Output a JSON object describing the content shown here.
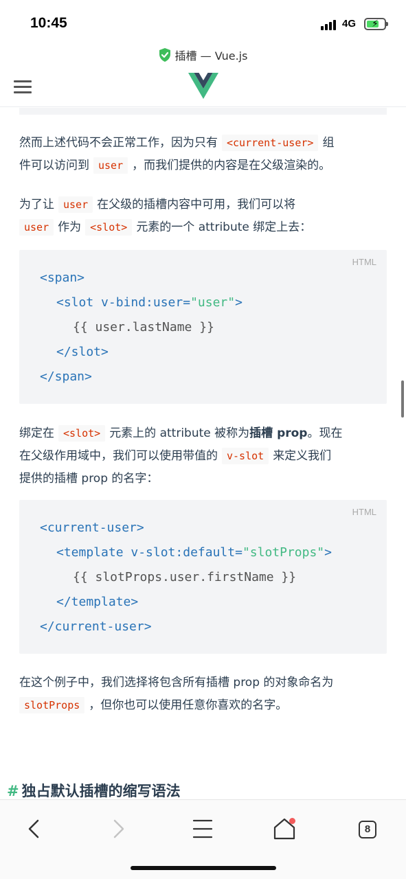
{
  "status_bar": {
    "time": "10:45",
    "network": "4G",
    "battery_level": 0.7,
    "battery_color": "#4cd964"
  },
  "browser": {
    "page_title": "插槽 — Vue.js",
    "secure_icon": "shield-check-icon"
  },
  "site": {
    "brand_colors": {
      "green": "#42b983",
      "dark": "#35495e"
    }
  },
  "content": {
    "p1": {
      "part1": "然而上述代码不会正常工作，因为只有",
      "code1": "<current-user>",
      "part2": "组",
      "part3": "件可以访问到",
      "code2": "user",
      "part4": "，而我们提供的内容是在父级渲染的。"
    },
    "p2": {
      "part1": "为了让",
      "code1": "user",
      "part2": "在父级的插槽内容中可用，我们可以将",
      "code2": "user",
      "part3": "作为",
      "code3": "<slot>",
      "part4": "元素的一个 attribute 绑定上去："
    },
    "code_block_1": {
      "lang": "HTML",
      "l1_tag": "<span>",
      "l2_tag_open": "<slot v-bind:user=",
      "l2_str": "\"user\"",
      "l2_tag_close": ">",
      "l3_plain": "{{ user.lastName }}",
      "l4_tag": "</slot>",
      "l5_tag": "</span>"
    },
    "p3": {
      "part1": "绑定在",
      "code1": "<slot>",
      "part2": "元素上的 attribute 被称为",
      "bold1": "插槽 prop",
      "part3": "。现在",
      "part4": "在父级作用域中，我们可以使用带值的",
      "code2": "v-slot",
      "part5": "来定义我们",
      "part6": "提供的插槽 prop 的名字："
    },
    "code_block_2": {
      "lang": "HTML",
      "l1_tag": "<current-user>",
      "l2_tag_open": "<template v-slot:default=",
      "l2_str": "\"slotProps\"",
      "l2_tag_close": ">",
      "l3_plain": "{{ slotProps.user.firstName }}",
      "l4_tag": "</template>",
      "l5_tag": "</current-user>"
    },
    "p4": {
      "part1": "在这个例子中，我们选择将包含所有插槽 prop 的对象命名为",
      "code1": "slotProps",
      "part2": "，但你也可以使用任意你喜欢的名字。"
    },
    "heading": {
      "hash": "#",
      "text": "独占默认插槽的缩写语法"
    }
  },
  "toolbar": {
    "tab_count": "8"
  }
}
